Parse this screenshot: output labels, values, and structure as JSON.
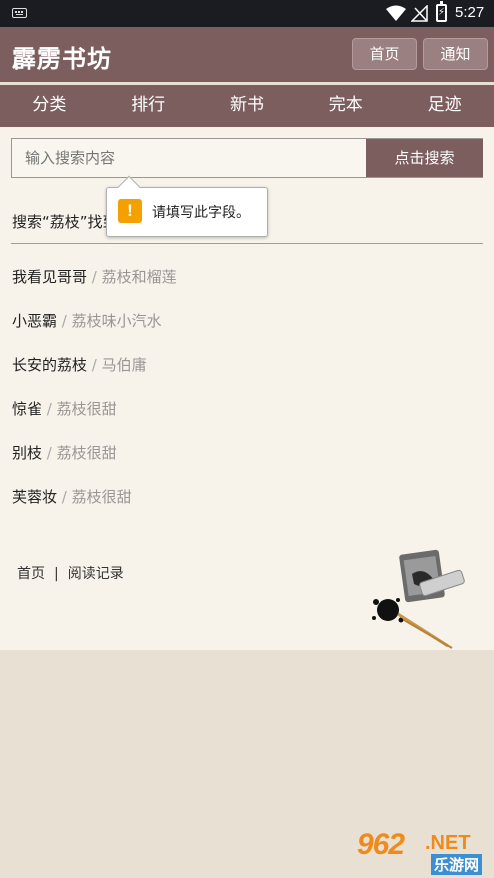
{
  "status_bar": {
    "time": "5:27",
    "battery_icon": "battery-charging-icon",
    "bolt": "⚡"
  },
  "header": {
    "logo": "霹雳书坊",
    "home_button": "首页",
    "notify_button": "通知"
  },
  "nav": {
    "tabs": [
      "分类",
      "排行",
      "新书",
      "完本",
      "足迹"
    ]
  },
  "search": {
    "placeholder": "输入搜索内容",
    "button": "点击搜索"
  },
  "tooltip": {
    "icon": "!",
    "message": "请填写此字段。"
  },
  "result_title": "搜索“荔枝”找到",
  "results": [
    {
      "title": "我看见哥哥",
      "author": "荔枝和榴莲"
    },
    {
      "title": "小恶霸",
      "author": "荔枝味小汽水"
    },
    {
      "title": "长安的荔枝",
      "author": "马伯庸"
    },
    {
      "title": "惊雀",
      "author": "荔枝很甜"
    },
    {
      "title": "别枝",
      "author": "荔枝很甜"
    },
    {
      "title": "芙蓉妆",
      "author": "荔枝很甜"
    }
  ],
  "separator": " / ",
  "footer": {
    "home": "首页",
    "divider": "|",
    "history": "阅读记录"
  },
  "watermark": {
    "number": "962",
    "domain": ".NET",
    "name": "乐游网"
  },
  "colors": {
    "brand": "#7d5e5f",
    "page": "#f7f3ea",
    "bottom": "#e8e1d3",
    "warning": "#f4a100"
  }
}
